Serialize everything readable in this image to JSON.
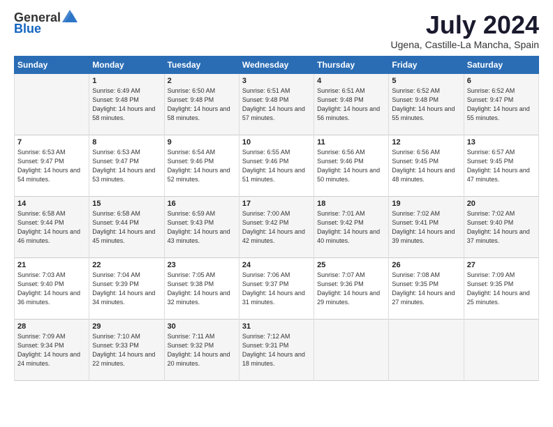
{
  "logo": {
    "general": "General",
    "blue": "Blue"
  },
  "header": {
    "month": "July 2024",
    "location": "Ugena, Castille-La Mancha, Spain"
  },
  "weekdays": [
    "Sunday",
    "Monday",
    "Tuesday",
    "Wednesday",
    "Thursday",
    "Friday",
    "Saturday"
  ],
  "weeks": [
    [
      {
        "day": "",
        "sunrise": "",
        "sunset": "",
        "daylight": ""
      },
      {
        "day": "1",
        "sunrise": "Sunrise: 6:49 AM",
        "sunset": "Sunset: 9:48 PM",
        "daylight": "Daylight: 14 hours and 58 minutes."
      },
      {
        "day": "2",
        "sunrise": "Sunrise: 6:50 AM",
        "sunset": "Sunset: 9:48 PM",
        "daylight": "Daylight: 14 hours and 58 minutes."
      },
      {
        "day": "3",
        "sunrise": "Sunrise: 6:51 AM",
        "sunset": "Sunset: 9:48 PM",
        "daylight": "Daylight: 14 hours and 57 minutes."
      },
      {
        "day": "4",
        "sunrise": "Sunrise: 6:51 AM",
        "sunset": "Sunset: 9:48 PM",
        "daylight": "Daylight: 14 hours and 56 minutes."
      },
      {
        "day": "5",
        "sunrise": "Sunrise: 6:52 AM",
        "sunset": "Sunset: 9:48 PM",
        "daylight": "Daylight: 14 hours and 55 minutes."
      },
      {
        "day": "6",
        "sunrise": "Sunrise: 6:52 AM",
        "sunset": "Sunset: 9:47 PM",
        "daylight": "Daylight: 14 hours and 55 minutes."
      }
    ],
    [
      {
        "day": "7",
        "sunrise": "Sunrise: 6:53 AM",
        "sunset": "Sunset: 9:47 PM",
        "daylight": "Daylight: 14 hours and 54 minutes."
      },
      {
        "day": "8",
        "sunrise": "Sunrise: 6:53 AM",
        "sunset": "Sunset: 9:47 PM",
        "daylight": "Daylight: 14 hours and 53 minutes."
      },
      {
        "day": "9",
        "sunrise": "Sunrise: 6:54 AM",
        "sunset": "Sunset: 9:46 PM",
        "daylight": "Daylight: 14 hours and 52 minutes."
      },
      {
        "day": "10",
        "sunrise": "Sunrise: 6:55 AM",
        "sunset": "Sunset: 9:46 PM",
        "daylight": "Daylight: 14 hours and 51 minutes."
      },
      {
        "day": "11",
        "sunrise": "Sunrise: 6:56 AM",
        "sunset": "Sunset: 9:46 PM",
        "daylight": "Daylight: 14 hours and 50 minutes."
      },
      {
        "day": "12",
        "sunrise": "Sunrise: 6:56 AM",
        "sunset": "Sunset: 9:45 PM",
        "daylight": "Daylight: 14 hours and 48 minutes."
      },
      {
        "day": "13",
        "sunrise": "Sunrise: 6:57 AM",
        "sunset": "Sunset: 9:45 PM",
        "daylight": "Daylight: 14 hours and 47 minutes."
      }
    ],
    [
      {
        "day": "14",
        "sunrise": "Sunrise: 6:58 AM",
        "sunset": "Sunset: 9:44 PM",
        "daylight": "Daylight: 14 hours and 46 minutes."
      },
      {
        "day": "15",
        "sunrise": "Sunrise: 6:58 AM",
        "sunset": "Sunset: 9:44 PM",
        "daylight": "Daylight: 14 hours and 45 minutes."
      },
      {
        "day": "16",
        "sunrise": "Sunrise: 6:59 AM",
        "sunset": "Sunset: 9:43 PM",
        "daylight": "Daylight: 14 hours and 43 minutes."
      },
      {
        "day": "17",
        "sunrise": "Sunrise: 7:00 AM",
        "sunset": "Sunset: 9:42 PM",
        "daylight": "Daylight: 14 hours and 42 minutes."
      },
      {
        "day": "18",
        "sunrise": "Sunrise: 7:01 AM",
        "sunset": "Sunset: 9:42 PM",
        "daylight": "Daylight: 14 hours and 40 minutes."
      },
      {
        "day": "19",
        "sunrise": "Sunrise: 7:02 AM",
        "sunset": "Sunset: 9:41 PM",
        "daylight": "Daylight: 14 hours and 39 minutes."
      },
      {
        "day": "20",
        "sunrise": "Sunrise: 7:02 AM",
        "sunset": "Sunset: 9:40 PM",
        "daylight": "Daylight: 14 hours and 37 minutes."
      }
    ],
    [
      {
        "day": "21",
        "sunrise": "Sunrise: 7:03 AM",
        "sunset": "Sunset: 9:40 PM",
        "daylight": "Daylight: 14 hours and 36 minutes."
      },
      {
        "day": "22",
        "sunrise": "Sunrise: 7:04 AM",
        "sunset": "Sunset: 9:39 PM",
        "daylight": "Daylight: 14 hours and 34 minutes."
      },
      {
        "day": "23",
        "sunrise": "Sunrise: 7:05 AM",
        "sunset": "Sunset: 9:38 PM",
        "daylight": "Daylight: 14 hours and 32 minutes."
      },
      {
        "day": "24",
        "sunrise": "Sunrise: 7:06 AM",
        "sunset": "Sunset: 9:37 PM",
        "daylight": "Daylight: 14 hours and 31 minutes."
      },
      {
        "day": "25",
        "sunrise": "Sunrise: 7:07 AM",
        "sunset": "Sunset: 9:36 PM",
        "daylight": "Daylight: 14 hours and 29 minutes."
      },
      {
        "day": "26",
        "sunrise": "Sunrise: 7:08 AM",
        "sunset": "Sunset: 9:35 PM",
        "daylight": "Daylight: 14 hours and 27 minutes."
      },
      {
        "day": "27",
        "sunrise": "Sunrise: 7:09 AM",
        "sunset": "Sunset: 9:35 PM",
        "daylight": "Daylight: 14 hours and 25 minutes."
      }
    ],
    [
      {
        "day": "28",
        "sunrise": "Sunrise: 7:09 AM",
        "sunset": "Sunset: 9:34 PM",
        "daylight": "Daylight: 14 hours and 24 minutes."
      },
      {
        "day": "29",
        "sunrise": "Sunrise: 7:10 AM",
        "sunset": "Sunset: 9:33 PM",
        "daylight": "Daylight: 14 hours and 22 minutes."
      },
      {
        "day": "30",
        "sunrise": "Sunrise: 7:11 AM",
        "sunset": "Sunset: 9:32 PM",
        "daylight": "Daylight: 14 hours and 20 minutes."
      },
      {
        "day": "31",
        "sunrise": "Sunrise: 7:12 AM",
        "sunset": "Sunset: 9:31 PM",
        "daylight": "Daylight: 14 hours and 18 minutes."
      },
      {
        "day": "",
        "sunrise": "",
        "sunset": "",
        "daylight": ""
      },
      {
        "day": "",
        "sunrise": "",
        "sunset": "",
        "daylight": ""
      },
      {
        "day": "",
        "sunrise": "",
        "sunset": "",
        "daylight": ""
      }
    ]
  ]
}
